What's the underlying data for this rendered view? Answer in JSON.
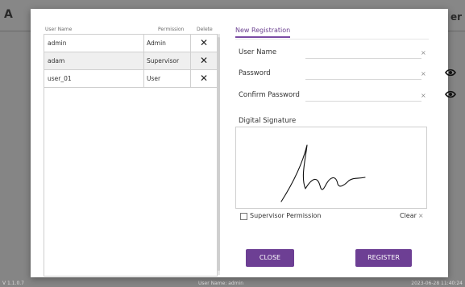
{
  "app": {
    "header_left": "A",
    "header_right": "er"
  },
  "footer": {
    "version": "V 1.1.0.7",
    "user": "User Name: admin",
    "datetime": "2023-06-28 11:40:24"
  },
  "users_table": {
    "headers": {
      "name": "User Name",
      "permission": "Permission",
      "delete": "Delete"
    },
    "rows": [
      {
        "name": "admin",
        "permission": "Admin"
      },
      {
        "name": "adam",
        "permission": "Supervisor"
      },
      {
        "name": "user_01",
        "permission": "User"
      }
    ],
    "delete_glyph": "✕"
  },
  "form": {
    "tab_label": "New Registration",
    "user_name_label": "User Name",
    "user_name_value": "",
    "password_label": "Password",
    "password_value": "",
    "confirm_label": "Confirm Password",
    "confirm_value": "",
    "clear_glyph": "×",
    "signature_title": "Digital Signature",
    "supervisor_label": "Supervisor Permission",
    "supervisor_checked": false,
    "clear_label": "Clear",
    "close_label": "CLOSE",
    "register_label": "REGISTER"
  },
  "colors": {
    "accent": "#6d3f94"
  },
  "icons": {
    "eye": "eye-icon",
    "delete": "close-icon",
    "clear": "clear-icon"
  }
}
